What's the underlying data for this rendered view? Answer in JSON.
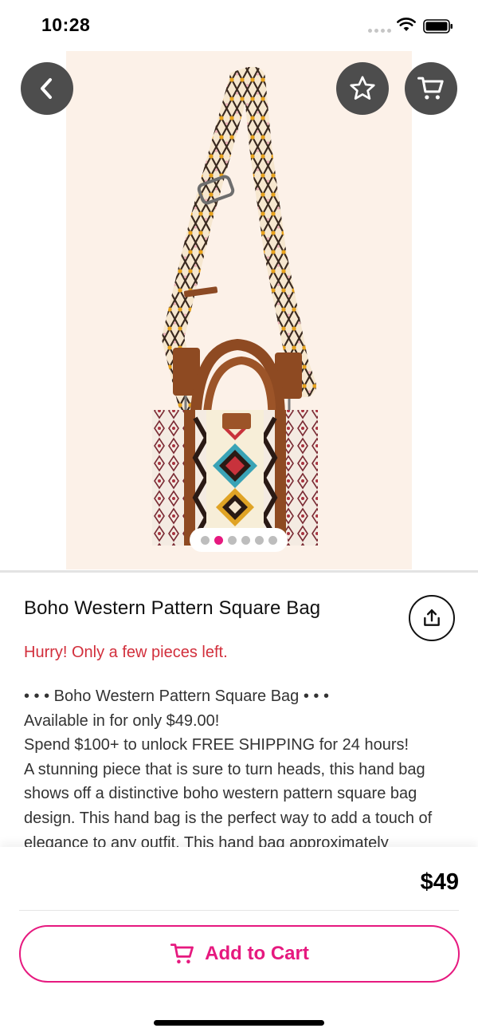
{
  "status_bar": {
    "time": "10:28"
  },
  "icons": {
    "back": "chevron-left-icon",
    "favorite": "star-icon",
    "cart": "cart-icon",
    "share": "share-icon",
    "add_to_cart": "cart-icon"
  },
  "gallery": {
    "image_count": 6,
    "active_index": 1
  },
  "product": {
    "title": "Boho Western Pattern Square Bag",
    "stock_note": "Hurry! Only a few pieces left.",
    "description_lines": [
      "• • • Boho Western Pattern Square Bag • • •",
      "Available in  for only $49.00!",
      "Spend $100+ to unlock FREE SHIPPING for 24 hours!",
      "A stunning piece that is sure to turn heads, this hand bag",
      "shows off a distinctive boho western pattern square bag",
      "design. This hand bag is the perfect way to add a touch of",
      "elegance to any outfit. This hand bag approximately"
    ],
    "price": "$49"
  },
  "actions": {
    "add_to_cart_label": "Add to Cart"
  },
  "colors": {
    "accent": "#e6197f",
    "alert": "#d22f3c",
    "overlay_button": "#4d4d4d",
    "image_bg": "#fcf1e8"
  }
}
